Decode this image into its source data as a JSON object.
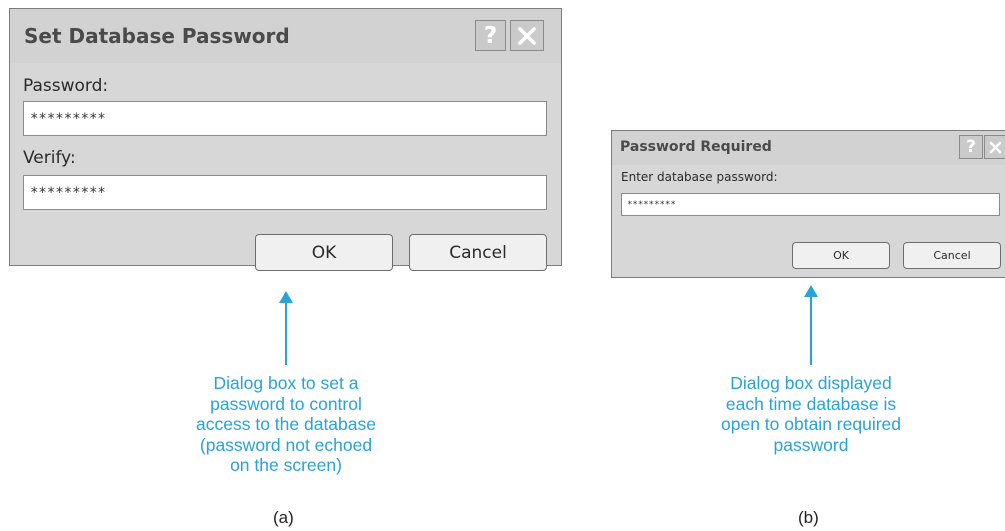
{
  "dialog_a": {
    "title": "Set Database Password",
    "help_button": "?",
    "password_label": "Password:",
    "password_value": "*********",
    "verify_label": "Verify:",
    "verify_value": "*********",
    "ok_label": "OK",
    "cancel_label": "Cancel"
  },
  "dialog_b": {
    "title": "Password Required",
    "help_button": "?",
    "prompt_label": "Enter database password:",
    "password_value": "*********",
    "ok_label": "OK",
    "cancel_label": "Cancel"
  },
  "caption_a": {
    "lines": [
      "Dialog box to set a",
      "password to control",
      "access to the database",
      "(password not echoed",
      "on the screen)"
    ],
    "letter": "(a)"
  },
  "caption_b": {
    "lines": [
      "Dialog box displayed",
      "each time database is",
      "open to obtain required",
      "password"
    ],
    "letter": "(b)"
  },
  "colors": {
    "accent": "#29a3d6",
    "dialog_bg": "#d7d7d7",
    "field_bg": "#ffffff"
  },
  "icons": {
    "help": "help-icon",
    "close": "close-icon",
    "arrow": "arrow-up-icon"
  }
}
